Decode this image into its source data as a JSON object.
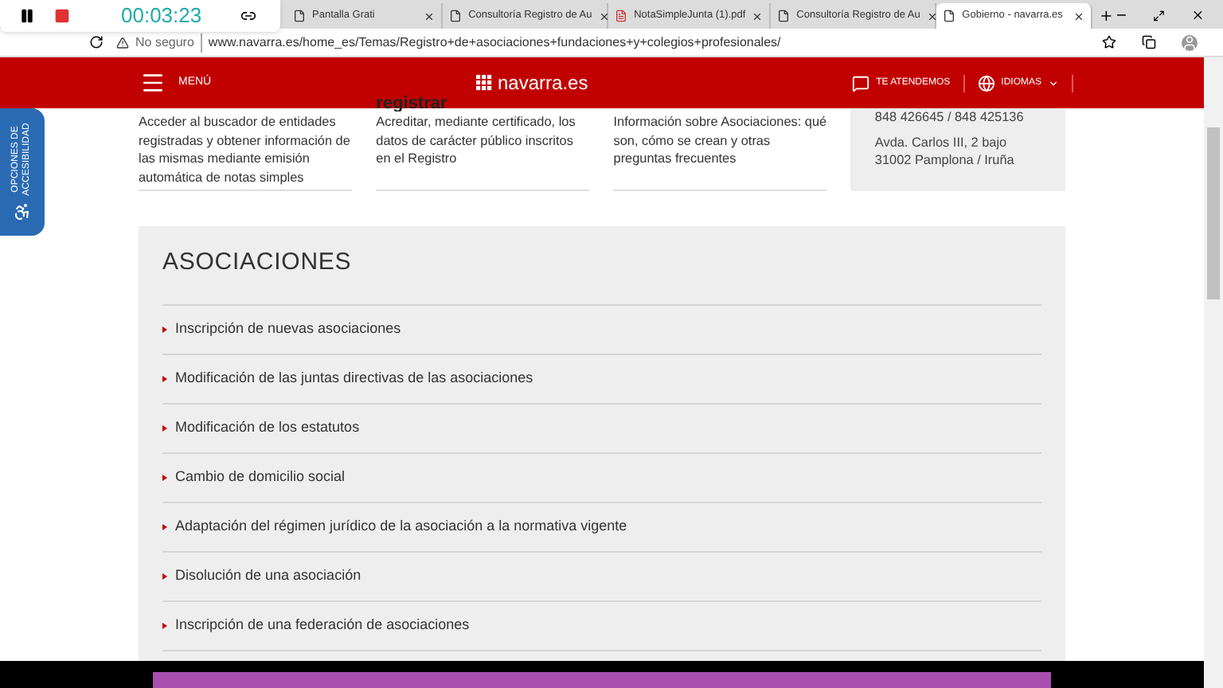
{
  "recorder": {
    "time": "00:03:23"
  },
  "tabs": [
    {
      "title": "Pantalla Grati",
      "kind": "page",
      "selected": false
    },
    {
      "title": "Consultoría Registro de Au",
      "kind": "page",
      "selected": false
    },
    {
      "title": "NotaSimpleJunta (1).pdf",
      "kind": "pdf",
      "selected": false
    },
    {
      "title": "Consultoría Registro de Au",
      "kind": "page",
      "selected": false
    },
    {
      "title": "Gobierno - navarra.es",
      "kind": "page",
      "selected": true
    }
  ],
  "address_bar": {
    "security": "No seguro",
    "url": "www.navarra.es/home_es/Temas/Registro+de+asociaciones+fundaciones+y+colegios+profesionales/"
  },
  "nav": {
    "menu": "MENÚ",
    "logo": "navarra.es",
    "contact": "TE ATENDEMOS",
    "language": "IDIOMAS"
  },
  "accessibility_tab": {
    "label": "OPCIONES DE ACCESIBILIDAD"
  },
  "cards": [
    {
      "text": "Acceder al buscador de entidades registradas y obtener información de las mismas mediante emisión automática de notas simples"
    },
    {
      "heading": "registrar",
      "text": "Acreditar, mediante certificado, los datos de carácter público inscritos en el Registro"
    },
    {
      "text": "Información sobre Asociaciones: qué son, cómo se crean y otras preguntas frecuentes"
    }
  ],
  "contact_card": {
    "lines": [
      "848 426645 / 848 425136",
      "Avda. Carlos III, 2 bajo",
      "31002 Pamplona / Iruña"
    ]
  },
  "section": {
    "title": "ASOCIACIONES",
    "items": [
      "Inscripción de nuevas asociaciones",
      "Modificación de las juntas directivas de las asociaciones",
      "Modificación de los estatutos",
      "Cambio de domicilio social",
      "Adaptación del régimen jurídico de la asociación a la normativa vigente",
      "Disolución de una asociación",
      "Inscripción de una federación de asociaciones"
    ]
  }
}
